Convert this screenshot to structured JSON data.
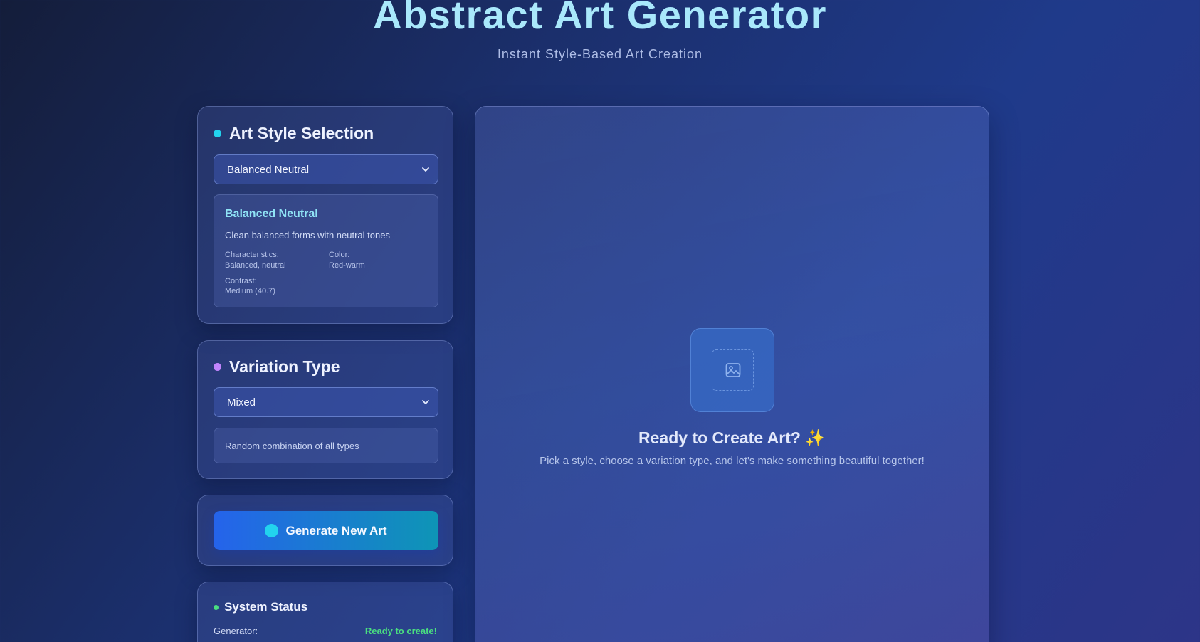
{
  "header": {
    "title": "Abstract Art Generator",
    "subtitle": "Instant Style-Based Art Creation"
  },
  "style_panel": {
    "title": "Art Style Selection",
    "selected": "Balanced Neutral",
    "info": {
      "name": "Balanced Neutral",
      "description": "Clean balanced forms with neutral tones",
      "characteristics_label": "Characteristics:",
      "characteristics_value": "Balanced, neutral",
      "color_label": "Color:",
      "color_value": "Red-warm",
      "contrast_label": "Contrast:",
      "contrast_value": "Medium (40.7)"
    }
  },
  "variation_panel": {
    "title": "Variation Type",
    "selected": "Mixed",
    "description": "Random combination of all types"
  },
  "generate": {
    "label": "Generate New Art"
  },
  "status_panel": {
    "title": "System Status",
    "generator_label": "Generator:",
    "generator_value": "Ready to create!"
  },
  "preview": {
    "heading": "Ready to Create Art? ✨",
    "message": "Pick a style, choose a variation type, and let's make something beautiful together!"
  },
  "colors": {
    "accent_cyan": "#22d3ee",
    "accent_purple": "#c084fc",
    "status_green": "#4ade80",
    "title_color": "#a9e8fb"
  },
  "icons": {
    "placeholder": "image-icon",
    "dropdown": "chevron-down-icon"
  }
}
